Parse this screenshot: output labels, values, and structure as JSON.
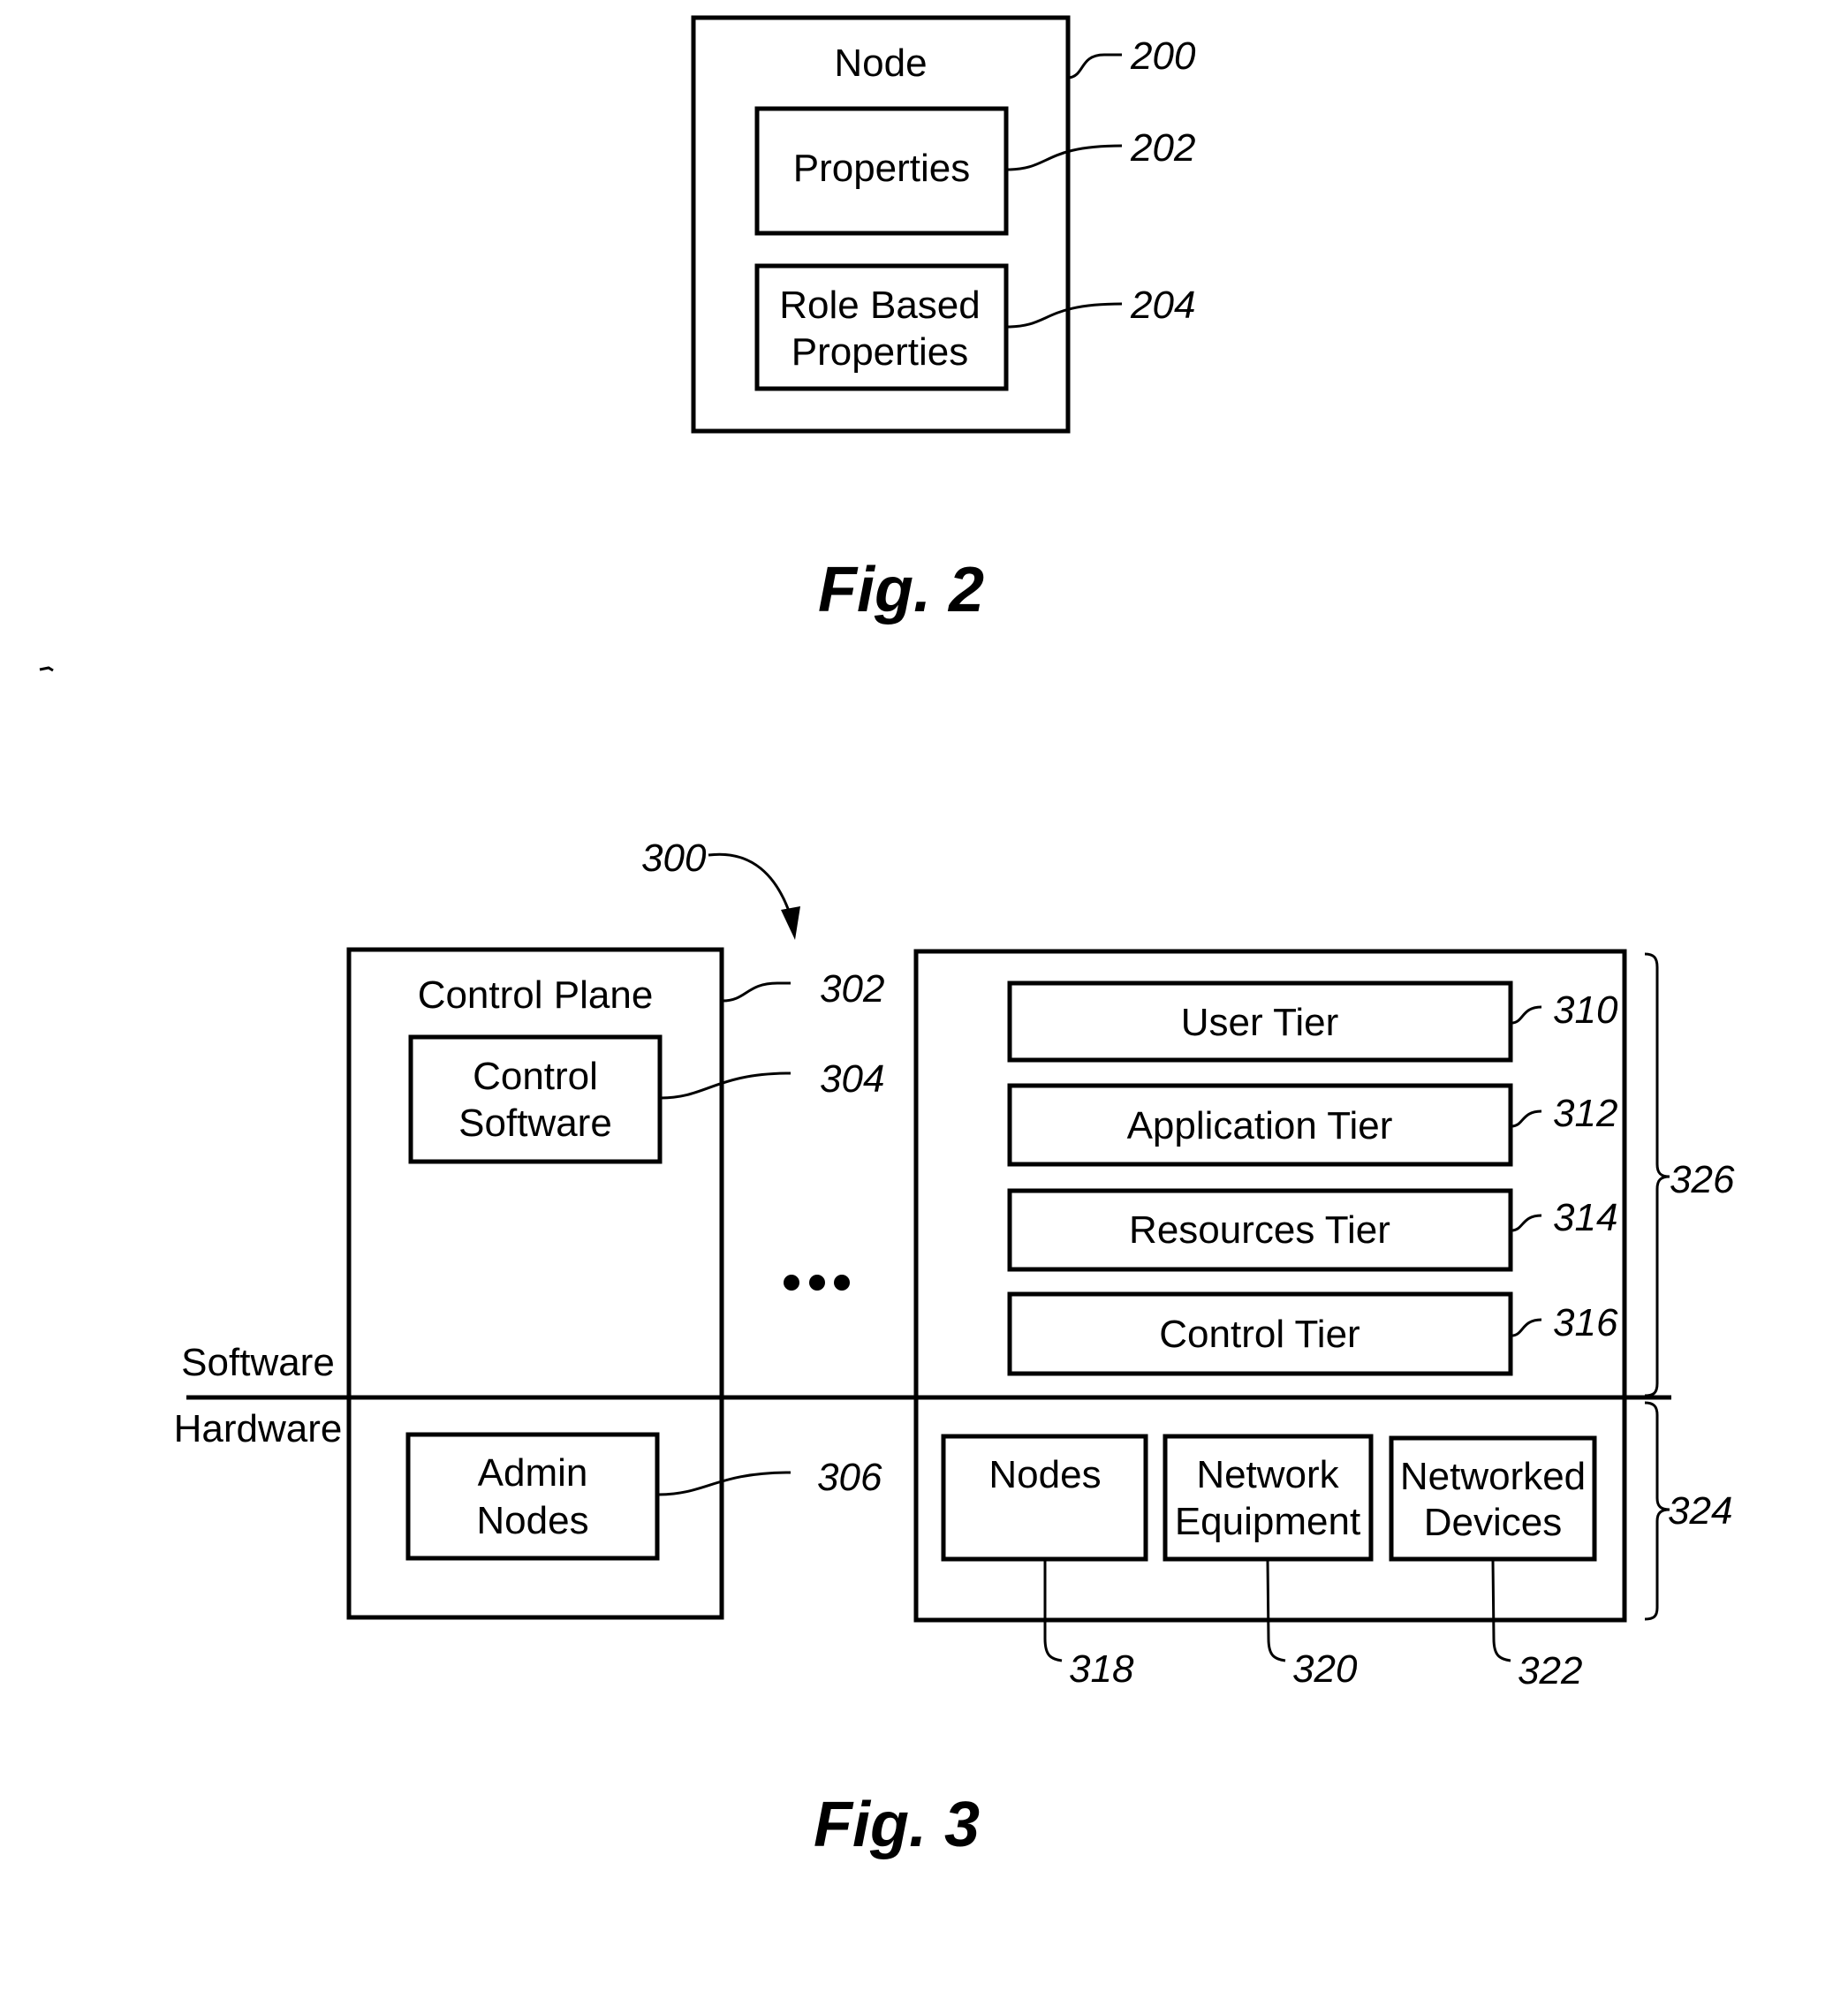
{
  "figure2": {
    "caption": "Fig. 2",
    "node": {
      "label": "Node",
      "ref": "200"
    },
    "properties": {
      "label": "Properties",
      "ref": "202"
    },
    "role_based_properties": {
      "line1": "Role Based",
      "line2": "Properties",
      "ref": "204"
    }
  },
  "figure3": {
    "caption": "Fig. 3",
    "system_ref": "300",
    "control_plane": {
      "label": "Control Plane",
      "ref": "302"
    },
    "control_software": {
      "line1": "Control",
      "line2": "Software",
      "ref": "304"
    },
    "admin_nodes": {
      "line1": "Admin",
      "line2": "Nodes",
      "ref": "306"
    },
    "ellipsis": "•••",
    "software_label": "Software",
    "hardware_label": "Hardware",
    "tiers": [
      {
        "label": "User Tier",
        "ref": "310"
      },
      {
        "label": "Application Tier",
        "ref": "312"
      },
      {
        "label": "Resources Tier",
        "ref": "314"
      },
      {
        "label": "Control Tier",
        "ref": "316"
      }
    ],
    "hardware_items": [
      {
        "line1": "Nodes",
        "line2": "",
        "ref": "318"
      },
      {
        "line1": "Network",
        "line2": "Equipment",
        "ref": "320"
      },
      {
        "line1": "Networked",
        "line2": "Devices",
        "ref": "322"
      }
    ],
    "software_brace_ref": "326",
    "hardware_brace_ref": "324"
  }
}
